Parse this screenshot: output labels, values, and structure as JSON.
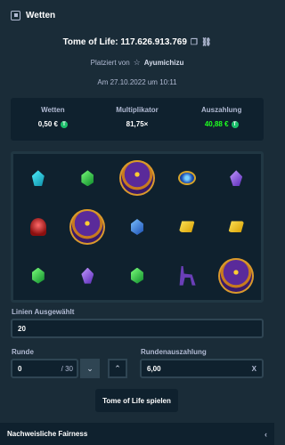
{
  "header": {
    "title": "Wetten",
    "icon": "bet-slip-icon"
  },
  "bet": {
    "label": "Tome of Life: 117.626.913.769",
    "placed_prefix": "Platziert von",
    "user": "Ayumichizu",
    "date": "Am 27.10.2022 um 10:11"
  },
  "stats": {
    "wager_label": "Wetten",
    "wager_value": "0,50 €",
    "multiplier_label": "Multiplikator",
    "multiplier_value": "81,75×",
    "payout_label": "Auszahlung",
    "payout_value": "40,88 €",
    "coin_symbol": "T",
    "payout_color": "#1fff20"
  },
  "grid": [
    [
      "gem-teal",
      "gem-green",
      "tome",
      "scarab",
      "gem-purple"
    ],
    [
      "helmet",
      "tome",
      "gem-blue",
      "gem-yellow",
      "gem-yellow"
    ],
    [
      "gem-green",
      "gem-purple",
      "gem-green",
      "anubis",
      "tome"
    ]
  ],
  "lines": {
    "label": "Linien Ausgewählt",
    "value": "20"
  },
  "round": {
    "label": "Runde",
    "value": "0",
    "total": "/ 30"
  },
  "round_payout": {
    "label": "Rundenauszahlung",
    "value": "6,00",
    "clear": "X"
  },
  "play_button": "Tome of Life spielen",
  "footer": {
    "label": "Nachweisliche Fairness"
  }
}
